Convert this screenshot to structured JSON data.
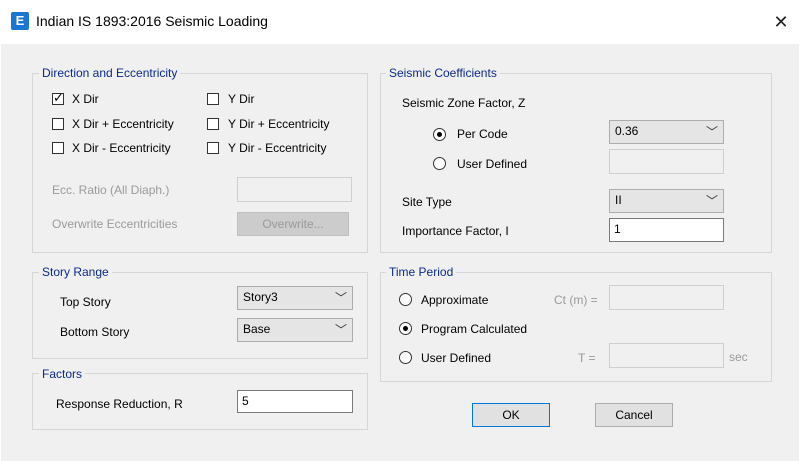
{
  "window": {
    "title": "Indian IS 1893:2016 Seismic Loading",
    "app_icon_letter": "E"
  },
  "direction": {
    "legend": "Direction and Eccentricity",
    "x_dir": "X Dir",
    "x_dir_ecc_plus": "X Dir + Eccentricity",
    "x_dir_ecc_minus": "X Dir - Eccentricity",
    "y_dir": "Y Dir",
    "y_dir_ecc_plus": "Y Dir + Eccentricity",
    "y_dir_ecc_minus": "Y Dir - Eccentricity",
    "ecc_ratio_label": "Ecc. Ratio (All Diaph.)",
    "ecc_ratio_value": "",
    "overwrite_label": "Overwrite Eccentricities",
    "overwrite_button": "Overwrite..."
  },
  "story_range": {
    "legend": "Story Range",
    "top_label": "Top Story",
    "top_value": "Story3",
    "bottom_label": "Bottom Story",
    "bottom_value": "Base"
  },
  "factors": {
    "legend": "Factors",
    "response_reduction_label": "Response Reduction, R",
    "response_reduction_value": "5"
  },
  "seismic": {
    "legend": "Seismic Coefficients",
    "zone_factor_label": "Seismic Zone Factor, Z",
    "per_code_label": "Per Code",
    "per_code_value": "0.36",
    "user_defined_label": "User Defined",
    "user_defined_value": "",
    "site_type_label": "Site Type",
    "site_type_value": "II",
    "importance_label": "Importance Factor, I",
    "importance_value": "1"
  },
  "time_period": {
    "legend": "Time Period",
    "approximate_label": "Approximate",
    "ct_label": "Ct (m) =",
    "ct_value": "",
    "program_calc_label": "Program Calculated",
    "user_defined_label": "User Defined",
    "t_label": "T =",
    "t_value": "",
    "sec_label": "sec"
  },
  "buttons": {
    "ok": "OK",
    "cancel": "Cancel"
  }
}
